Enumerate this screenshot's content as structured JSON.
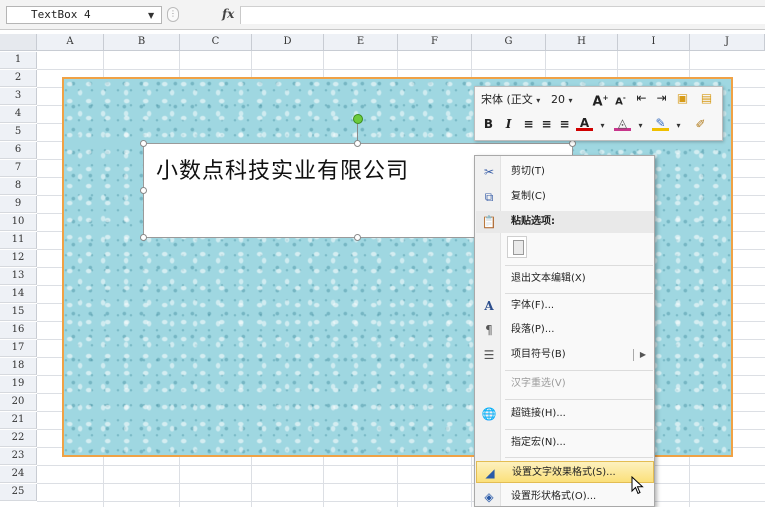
{
  "formula_bar": {
    "name_box": "TextBox 4",
    "fx_label": "fx",
    "formula": ""
  },
  "columns": [
    "A",
    "B",
    "C",
    "D",
    "E",
    "F",
    "G",
    "H",
    "I",
    "J"
  ],
  "rows": [
    "1",
    "2",
    "3",
    "4",
    "5",
    "6",
    "7",
    "8",
    "9",
    "10",
    "11",
    "12",
    "13",
    "14",
    "15",
    "16",
    "17",
    "18",
    "19",
    "20",
    "21",
    "22",
    "23",
    "24",
    "25"
  ],
  "shape": {
    "fill_color": "#9fd7e1",
    "border_color": "#f0a245",
    "textbox_text": "小数点科技实业有限公司"
  },
  "mini_toolbar": {
    "font_name": "宋体 (正文",
    "font_size": "20",
    "row1_icons": [
      "grow-font-icon",
      "shrink-font-icon",
      "decrease-indent-icon",
      "increase-indent-icon",
      "format-painter-icon",
      "copy-format-icon"
    ],
    "row2_icons": [
      "bold-icon",
      "italic-icon",
      "align-left-icon",
      "align-center-icon",
      "align-right-icon",
      "font-color-icon",
      "fill-color-icon",
      "shape-outline-icon",
      "eraser-icon"
    ]
  },
  "context_menu": {
    "items": [
      {
        "label": "剪切(T)",
        "icon": "cut-icon"
      },
      {
        "label": "复制(C)",
        "icon": "copy-icon"
      },
      {
        "label": "粘贴选项:",
        "icon": "paste-icon"
      },
      {
        "label": "退出文本编辑(X)",
        "icon": ""
      },
      {
        "label": "字体(F)...",
        "icon": "font-icon"
      },
      {
        "label": "段落(P)...",
        "icon": "paragraph-icon"
      },
      {
        "label": "项目符号(B)",
        "icon": "bullets-icon"
      },
      {
        "label": "汉字重选(V)",
        "icon": ""
      },
      {
        "label": "超链接(H)...",
        "icon": "hyperlink-icon"
      },
      {
        "label": "指定宏(N)...",
        "icon": ""
      },
      {
        "label": "设置文字效果格式(S)...",
        "icon": "text-effects-icon"
      },
      {
        "label": "设置形状格式(O)...",
        "icon": "shape-format-icon"
      }
    ]
  }
}
